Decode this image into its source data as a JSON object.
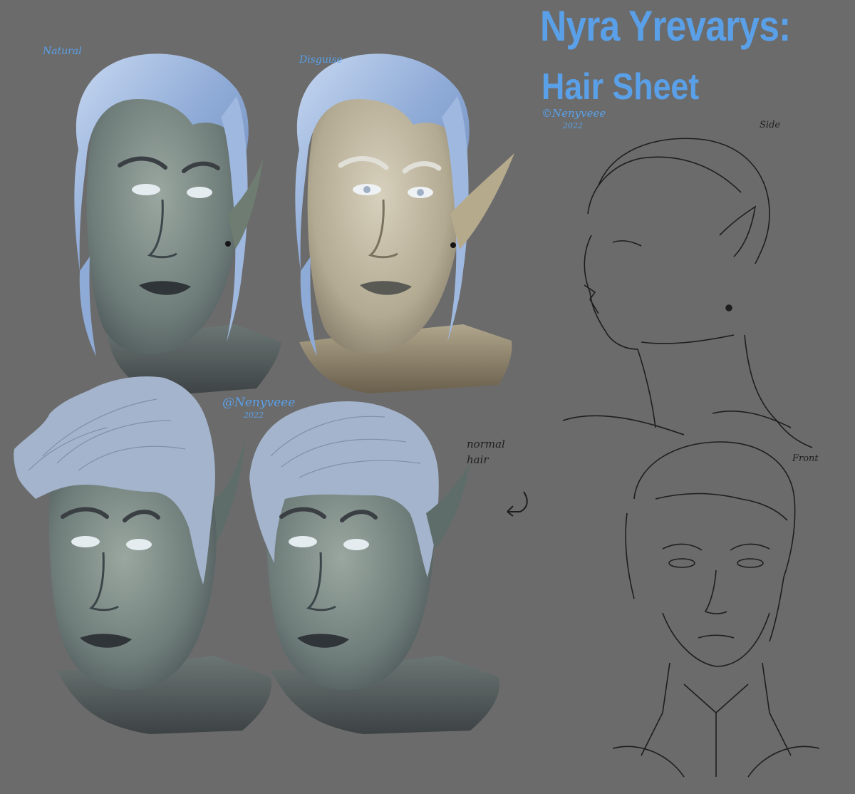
{
  "title": {
    "line1": "Nyra Yrevarys:",
    "line2": "Hair Sheet"
  },
  "labels": {
    "natural": "Natural",
    "disguise": "Disguise",
    "side": "Side",
    "front": "Front",
    "normal_hair_1": "normal",
    "normal_hair_2": "hair"
  },
  "signatures": {
    "top_handle": "©Nenyveee",
    "top_year": "2022",
    "mid_handle": "@Nenyveee",
    "mid_year": "2022"
  },
  "colors": {
    "background": "#6b6b6b",
    "title": "#5aa0e8",
    "hair_natural": "#a8c2e6",
    "hair_sketch": "#a3b4cc",
    "skin_natural": "#7d8c88",
    "skin_disguise": "#bfb8a4",
    "sketch_line": "#1e1e1e"
  }
}
